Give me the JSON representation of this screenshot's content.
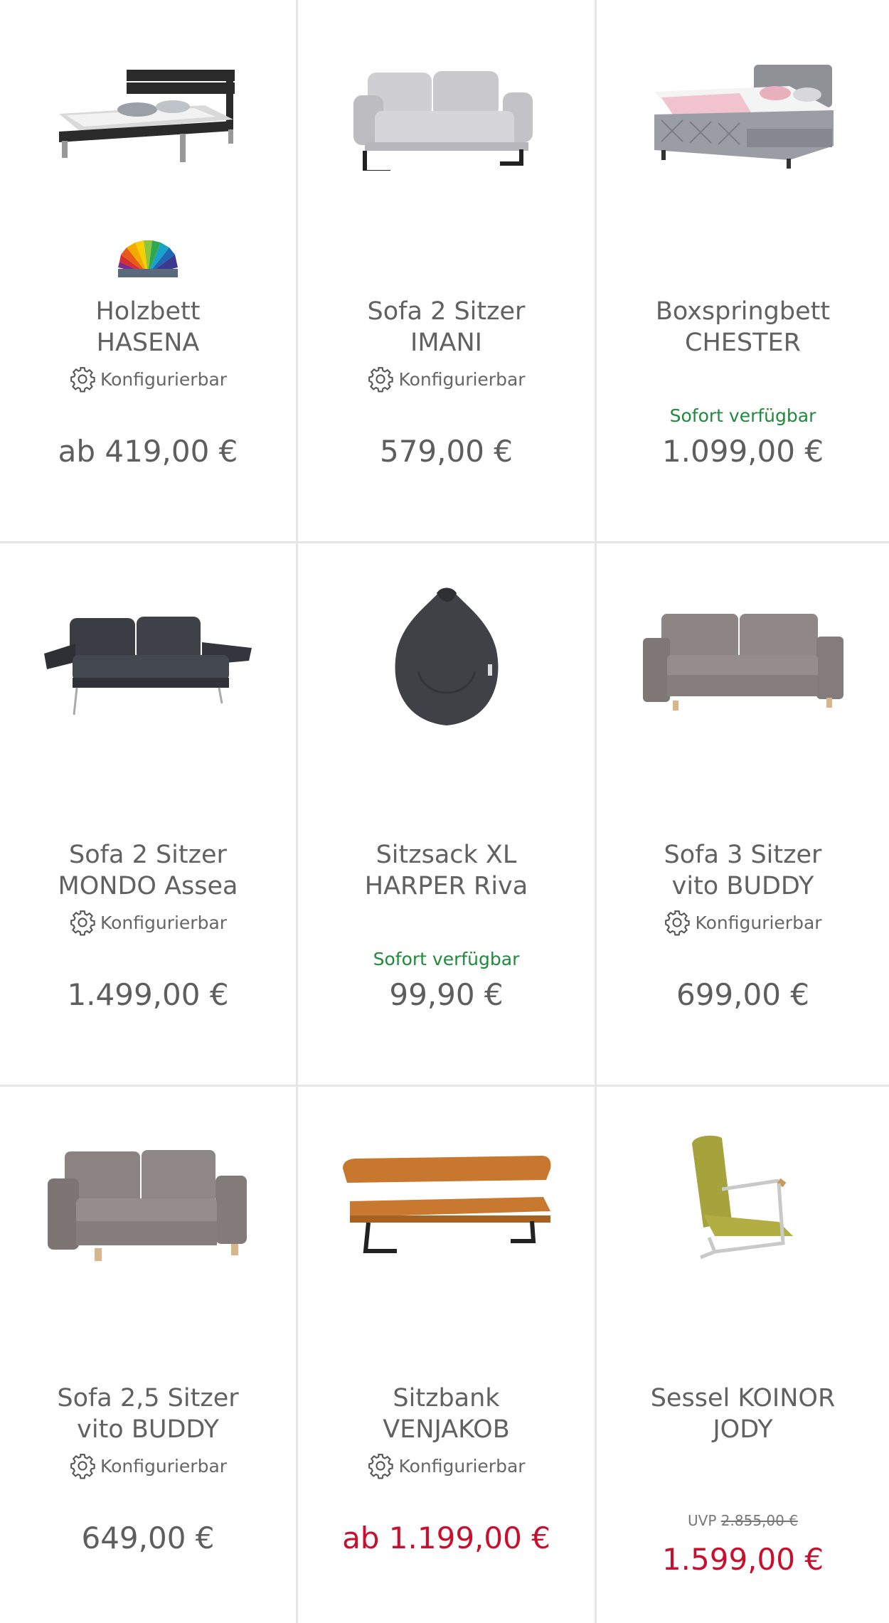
{
  "products": [
    {
      "title1": "Holzbett",
      "title2": "HASENA",
      "config_label": "Konfigurierbar",
      "price": "ab 419,00 €"
    },
    {
      "title1": "Sofa 2 Sitzer",
      "title2": "IMANI",
      "config_label": "Konfigurierbar",
      "price": "579,00 €"
    },
    {
      "title1": "Boxspringbett",
      "title2": "CHESTER",
      "availability": "Sofort verfügbar",
      "price": "1.099,00 €"
    },
    {
      "title1": "Sofa 2 Sitzer",
      "title2": "MONDO Assea",
      "config_label": "Konfigurierbar",
      "price": "1.499,00 €"
    },
    {
      "title1": "Sitzsack XL",
      "title2": "HARPER Riva",
      "availability": "Sofort verfügbar",
      "price": "99,90 €"
    },
    {
      "title1": "Sofa 3 Sitzer",
      "title2": "vito BUDDY",
      "config_label": "Konfigurierbar",
      "price": "699,00 €"
    },
    {
      "title1": "Sofa 2,5 Sitzer",
      "title2": "vito BUDDY",
      "config_label": "Konfigurierbar",
      "price": "649,00 €"
    },
    {
      "title1": "Sitzbank",
      "title2": "VENJAKOB",
      "config_label": "Konfigurierbar",
      "price": "ab 1.199,00 €"
    },
    {
      "title1": "Sessel KOINOR",
      "title2": "JODY",
      "uvp_label": "UVP",
      "uvp_price": "2.855,00 €",
      "price": "1.599,00 €"
    }
  ],
  "colors": {
    "available": "#1f8a3c",
    "sale": "#c8102e",
    "text": "#616161",
    "divider": "#e6e6e6"
  }
}
